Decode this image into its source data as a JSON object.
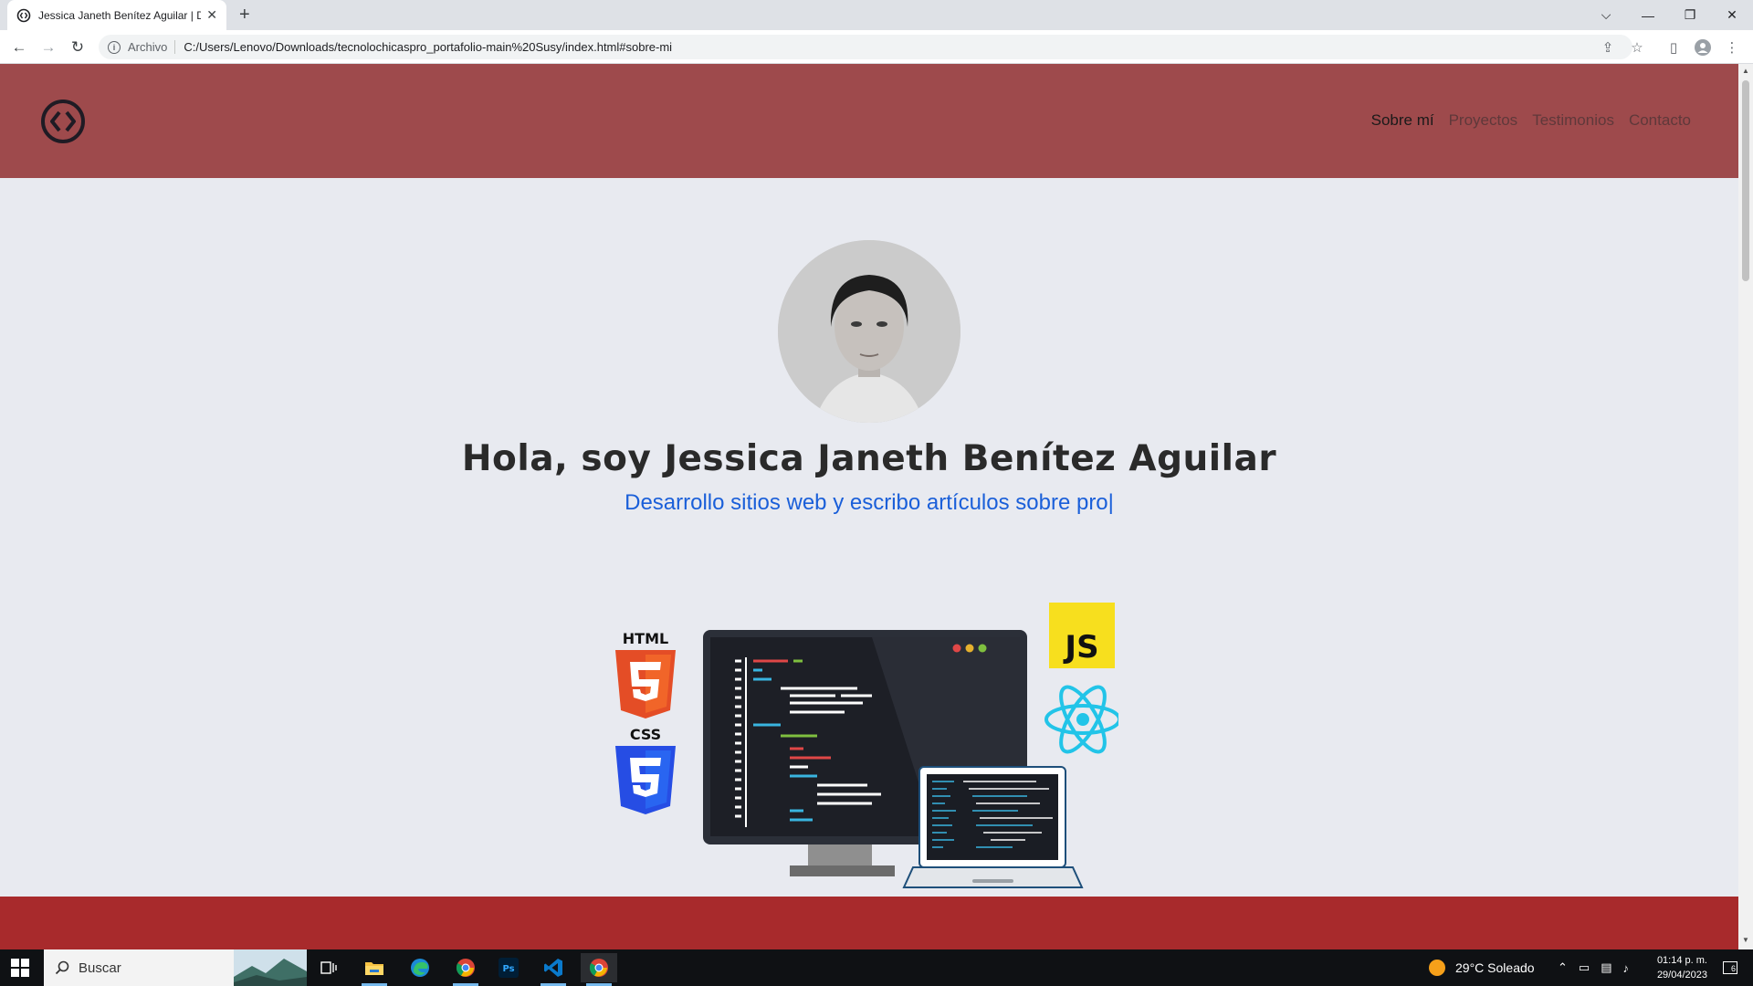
{
  "browser": {
    "tab_title": "Jessica Janeth Benítez Aguilar | D",
    "tab_close": "✕",
    "new_tab": "+",
    "address_scheme": "Archivo",
    "address_url": "C:/Users/Lenovo/Downloads/tecnolochicaspro_portafolio-main%20Susy/index.html#sobre-mi"
  },
  "site": {
    "nav": [
      {
        "label": "Sobre mí"
      },
      {
        "label": "Proyectos"
      },
      {
        "label": "Testimonios"
      },
      {
        "label": "Contacto"
      }
    ],
    "hero_title": "Hola, soy Jessica Janeth Benítez Aguilar",
    "hero_subtitle": "Desarrollo sitios web y escribo artículos sobre pro|",
    "illustration_labels": {
      "html": "HTML",
      "css": "CSS",
      "js": "JS"
    },
    "colors": {
      "header": "#9e4a4c",
      "footer_band": "#a82a2c",
      "subtitle": "#1a5fd9"
    }
  },
  "taskbar": {
    "search_placeholder": "Buscar",
    "weather": "29°C  Soleado",
    "time": "01:14 p. m.",
    "date": "29/04/2023",
    "notification_count": "6"
  }
}
